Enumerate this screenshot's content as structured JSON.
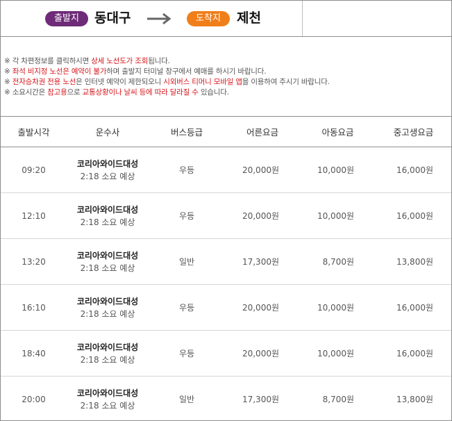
{
  "route": {
    "departure_badge": "출발지",
    "departure_city": "동대구",
    "arrival_badge": "도착지",
    "arrival_city": "제천",
    "colors": {
      "departure": "#6e2b78",
      "arrival": "#f07f1b",
      "arrow": "#666666"
    },
    "arrow_icon": "right-arrow-icon"
  },
  "notices": [
    {
      "parts": [
        {
          "text": "※ 각 차편정보를 클릭하시면 ",
          "red": false
        },
        {
          "text": "상세 노선도가 조회",
          "red": true
        },
        {
          "text": "됩니다.",
          "red": false
        }
      ]
    },
    {
      "parts": [
        {
          "text": "※ ",
          "red": false
        },
        {
          "text": "좌석 비지정 노선은 예약이 불가",
          "red": true
        },
        {
          "text": "하며 출발지 터미널 창구에서 예매를 하시기 바랍니다.",
          "red": false
        }
      ]
    },
    {
      "parts": [
        {
          "text": "※ ",
          "red": false
        },
        {
          "text": "전자승차권 전용 노선",
          "red": true
        },
        {
          "text": "은 인터넷 예약이 제한되오니 ",
          "red": false
        },
        {
          "text": "시외버스 티머니 모바일 앱",
          "red": true
        },
        {
          "text": "을 이용하여 주시기 바랍니다.",
          "red": false
        }
      ]
    },
    {
      "parts": [
        {
          "text": "※ 소요시간은 ",
          "red": false
        },
        {
          "text": "참고용",
          "red": true
        },
        {
          "text": "으로 ",
          "red": false
        },
        {
          "text": "교통상황이나 날씨 등에 따라 달라질 수",
          "red": true
        },
        {
          "text": " 있습니다.",
          "red": false
        }
      ]
    }
  ],
  "table": {
    "headers": {
      "time": "출발시각",
      "company": "운수사",
      "grade": "버스등급",
      "adult": "어른요금",
      "child": "아동요금",
      "student": "중고생요금"
    },
    "rows": [
      {
        "time": "09:20",
        "company": "코리아와이드대성",
        "duration": "2:18 소요 예상",
        "grade": "우등",
        "adult": "20,000원",
        "child": "10,000원",
        "student": "16,000원"
      },
      {
        "time": "12:10",
        "company": "코리아와이드대성",
        "duration": "2:18 소요 예상",
        "grade": "우등",
        "adult": "20,000원",
        "child": "10,000원",
        "student": "16,000원"
      },
      {
        "time": "13:20",
        "company": "코리아와이드대성",
        "duration": "2:18 소요 예상",
        "grade": "일반",
        "adult": "17,300원",
        "child": "8,700원",
        "student": "13,800원"
      },
      {
        "time": "16:10",
        "company": "코리아와이드대성",
        "duration": "2:18 소요 예상",
        "grade": "우등",
        "adult": "20,000원",
        "child": "10,000원",
        "student": "16,000원"
      },
      {
        "time": "18:40",
        "company": "코리아와이드대성",
        "duration": "2:18 소요 예상",
        "grade": "우등",
        "adult": "20,000원",
        "child": "10,000원",
        "student": "16,000원"
      },
      {
        "time": "20:00",
        "company": "코리아와이드대성",
        "duration": "2:18 소요 예상",
        "grade": "일반",
        "adult": "17,300원",
        "child": "8,700원",
        "student": "13,800원"
      }
    ]
  }
}
